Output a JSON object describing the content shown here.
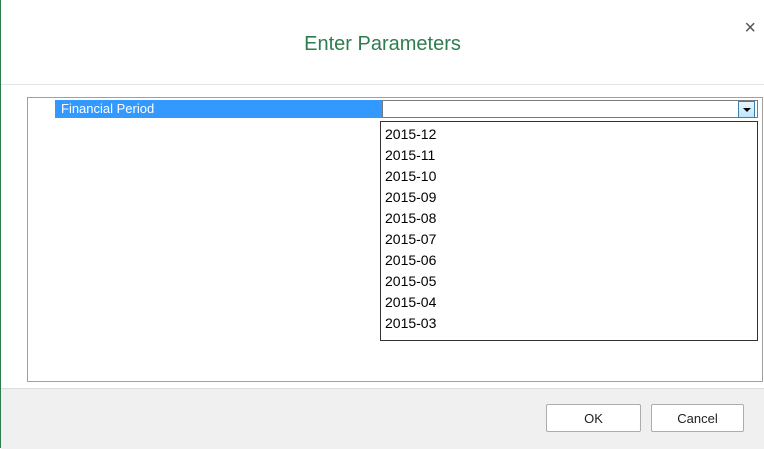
{
  "dialog": {
    "title": "Enter Parameters",
    "close_symbol": "×"
  },
  "parameter": {
    "label": "Financial Period",
    "selected_value": "",
    "options": [
      "2015-12",
      "2015-11",
      "2015-10",
      "2015-09",
      "2015-08",
      "2015-07",
      "2015-06",
      "2015-05",
      "2015-04",
      "2015-03"
    ]
  },
  "buttons": {
    "ok_label": "OK",
    "cancel_label": "Cancel"
  },
  "colors": {
    "title": "#2e7d4f",
    "highlight": "#3399ff"
  },
  "icons": {
    "close": "close-icon",
    "dropdown": "chevron-down-icon"
  }
}
